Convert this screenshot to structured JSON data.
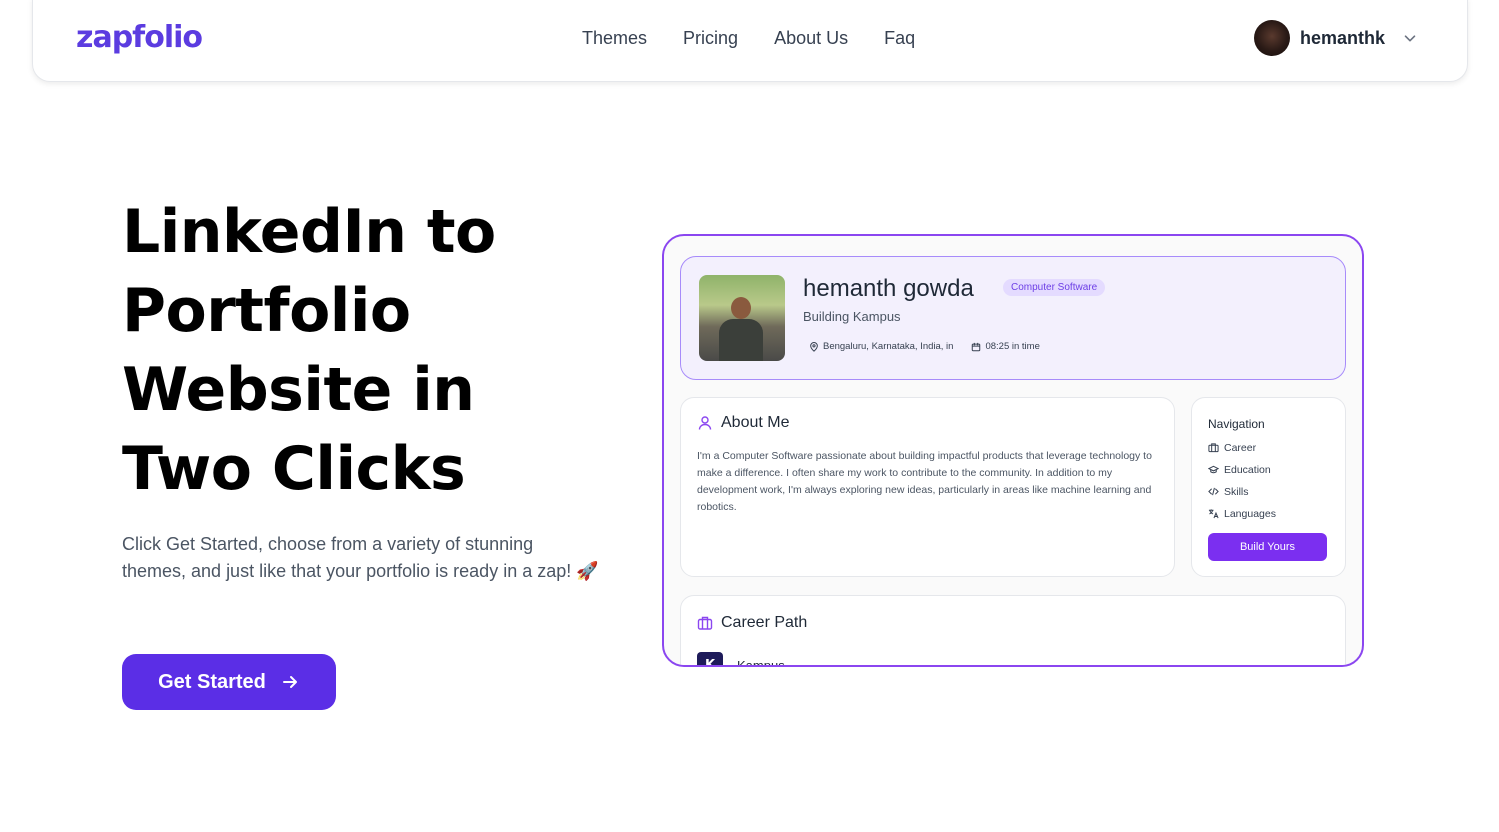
{
  "nav": {
    "logo": "zapfolio",
    "links": [
      "Themes",
      "Pricing",
      "About Us",
      "Faq"
    ],
    "user_name": "hemanthk"
  },
  "hero": {
    "title": "LinkedIn to Portfolio Website in Two Clicks",
    "subtitle": "Click Get Started, choose from a variety of stunning themes, and just like that your portfolio is ready in a zap! 🚀",
    "cta_label": "Get Started"
  },
  "preview": {
    "profile": {
      "name": "hemanth gowda",
      "badge": "Computer Software",
      "role": "Building Kampus",
      "location": "Bengaluru, Karnataka, India, in",
      "time": "08:25 in time"
    },
    "about": {
      "title": "About Me",
      "text": "I'm a Computer Software passionate about building impactful products that leverage technology to make a difference. I often share my work to contribute to the community. In addition to my development work, I'm always exploring new ideas, particularly in areas like machine learning and robotics."
    },
    "navigation": {
      "title": "Navigation",
      "items": [
        "Career",
        "Education",
        "Skills",
        "Languages"
      ],
      "button": "Build Yours"
    },
    "career": {
      "title": "Career Path",
      "company": "Kampus",
      "company_logo_letter": "K"
    }
  },
  "colors": {
    "brand": "#5b3ce0",
    "cta": "#5b2ee6",
    "preview_border": "#8b46f0",
    "badge_bg": "#e4dbff"
  }
}
